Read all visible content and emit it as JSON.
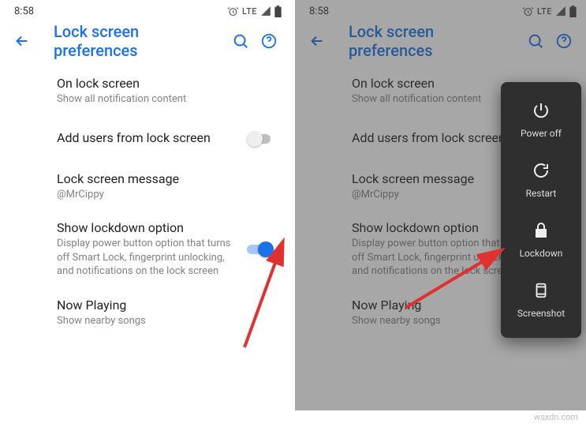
{
  "status": {
    "time": "8:58",
    "lte": "LTE"
  },
  "appbar": {
    "title": "Lock screen preferences"
  },
  "settings": {
    "onlock": {
      "title": "On lock screen",
      "sub": "Show all notification content"
    },
    "adduser": {
      "title": "Add users from lock screen"
    },
    "message": {
      "title": "Lock screen message",
      "sub": "@MrCippy"
    },
    "lockdown": {
      "title": "Show lockdown option",
      "sub": "Display power button option that turns off Smart Lock, fingerprint unlocking, and notifications on the lock screen"
    },
    "nowplay": {
      "title": "Now Playing",
      "sub": "Show nearby songs"
    }
  },
  "power_menu": {
    "poweroff": "Power off",
    "restart": "Restart",
    "lockdown": "Lockdown",
    "screenshot": "Screenshot"
  },
  "watermark": "wsxdn.com"
}
